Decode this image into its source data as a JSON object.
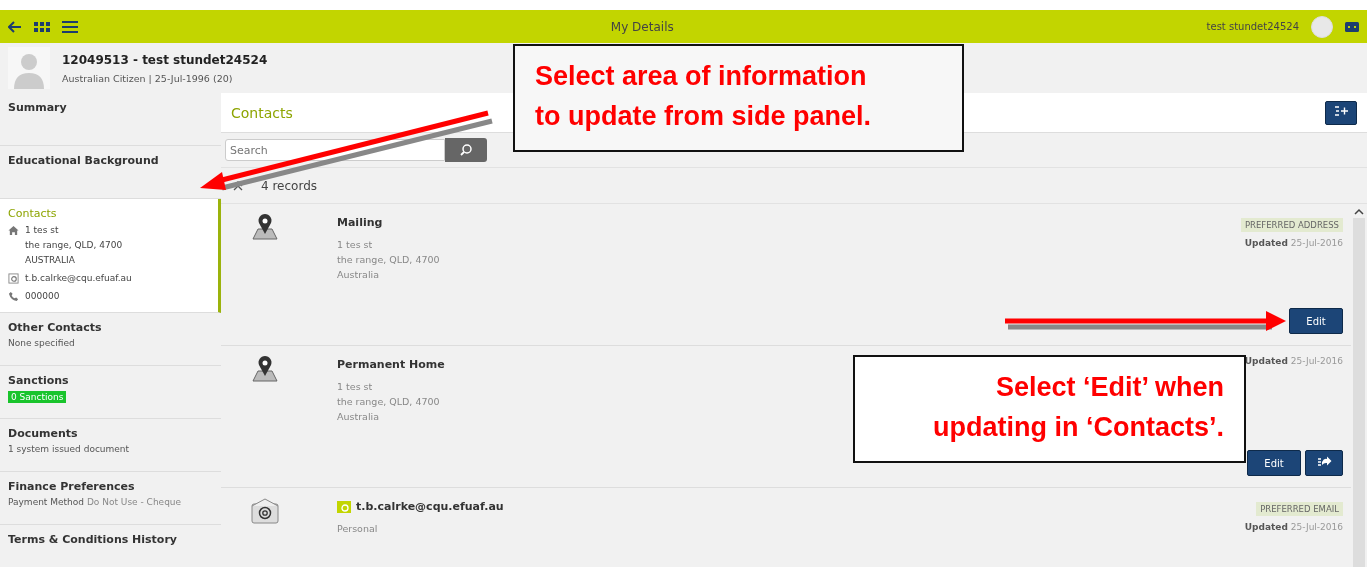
{
  "top_bar": {
    "title": "My Details",
    "user_name": "test stundet24524"
  },
  "profile": {
    "name": "12049513 - test stundet24524",
    "subtitle": "Australian Citizen | 25-Jul-1996 (20)"
  },
  "sidebar": {
    "items": [
      {
        "kind": "plain",
        "title": "Summary",
        "selected": false
      },
      {
        "kind": "plain",
        "title": "Educational Background",
        "selected": false
      },
      {
        "kind": "contacts",
        "title": "Contacts",
        "selected": true,
        "details": [
          {
            "kind": "home",
            "lines": [
              "1 tes st",
              "the range, QLD, 4700",
              "AUSTRALIA"
            ]
          },
          {
            "kind": "email",
            "lines": [
              "t.b.calrke@cqu.efuaf.au"
            ]
          },
          {
            "kind": "phone",
            "lines": [
              "000000"
            ]
          }
        ]
      },
      {
        "kind": "text",
        "title": "Other Contacts",
        "selected": false,
        "subtitle": "None specified"
      },
      {
        "kind": "badge",
        "title": "Sanctions",
        "selected": false,
        "badge": "0 Sanctions"
      },
      {
        "kind": "text",
        "title": "Documents",
        "selected": false,
        "subtitle": "1 system issued document"
      },
      {
        "kind": "pair",
        "title": "Finance Preferences",
        "selected": false,
        "label": "Payment Method",
        "value": "Do Not Use - Cheque"
      },
      {
        "kind": "plain",
        "title": "Terms & Conditions History",
        "selected": false
      }
    ]
  },
  "main": {
    "title": "Contacts",
    "search": {
      "placeholder": "Search"
    },
    "record_count": "4 records",
    "records": [
      {
        "kind": "address",
        "title": "Mailing",
        "lines": [
          "1 tes st",
          "the range, QLD, 4700",
          "Australia"
        ],
        "badge": "PREFERRED ADDRESS",
        "updated_label": "Updated",
        "updated_date": "25-Jul-2016",
        "buttons": [
          {
            "kind": "text",
            "label": "Edit"
          }
        ]
      },
      {
        "kind": "address",
        "title": "Permanent Home",
        "lines": [
          "1 tes st",
          "the range, QLD, 4700",
          "Australia"
        ],
        "updated_label": "Updated",
        "updated_date": "25-Jul-2016",
        "buttons": [
          {
            "kind": "text",
            "label": "Edit"
          },
          {
            "kind": "icon"
          }
        ]
      },
      {
        "kind": "email",
        "title": "t.b.calrke@cqu.efuaf.au",
        "lines": [
          "Personal"
        ],
        "badge": "PREFERRED EMAIL",
        "updated_label": "Updated",
        "updated_date": "25-Jul-2016"
      }
    ]
  },
  "callouts": [
    {
      "text": "Select area of information\nto update from side panel."
    },
    {
      "text": "Select ‘Edit’ when\nupdating in ‘Contacts’."
    }
  ]
}
